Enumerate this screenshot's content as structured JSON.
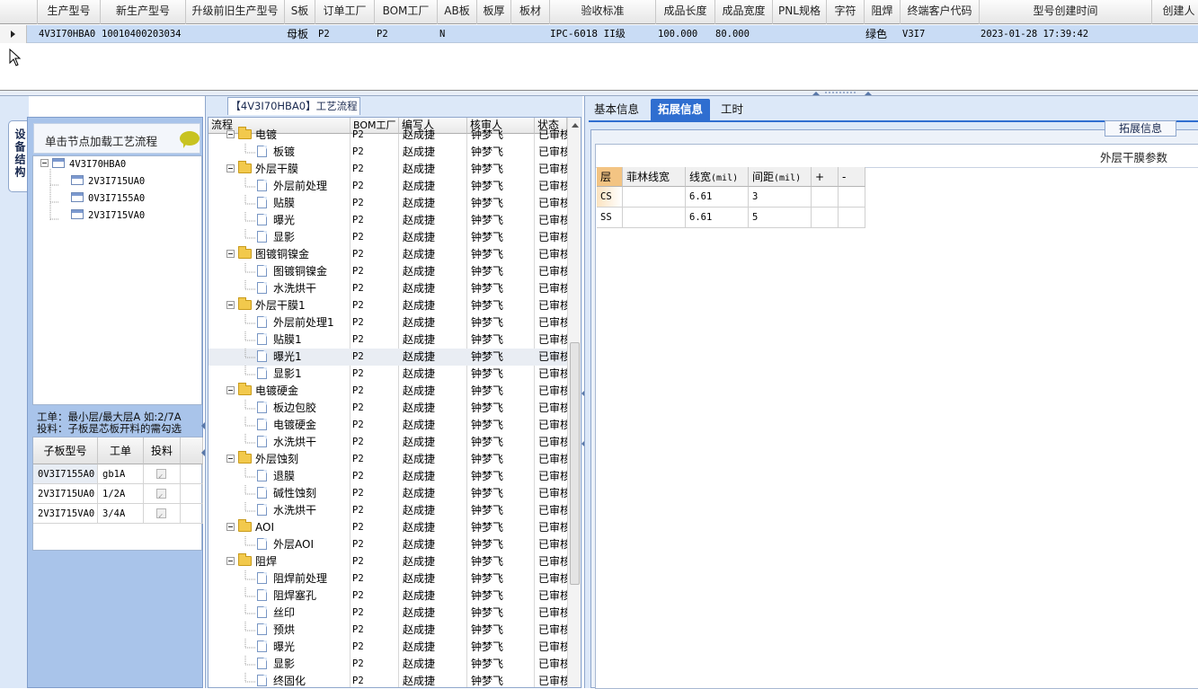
{
  "top_grid": {
    "columns": [
      "生产型号",
      "新生产型号",
      "升级前旧生产型号",
      "S板",
      "订单工厂",
      "BOM工厂",
      "AB板",
      "板厚",
      "板材",
      "验收标准",
      "成品长度",
      "成品宽度",
      "PNL规格",
      "字符",
      "阻焊",
      "终端客户代码",
      "型号创建时间",
      "创建人"
    ],
    "row": {
      "prod_no": "4V3I70HBA0",
      "new_prod_no": "10010400203034",
      "old_prod_no": "",
      "s_board": "母板",
      "order_factory": "P2",
      "bom_factory": "P2",
      "ab_board": "N",
      "thickness": "",
      "material": "",
      "standard": "IPC-6018 II级",
      "length": "100.000",
      "width": "80.000",
      "pnl": "",
      "char": "",
      "solder_mask": "绿色",
      "customer_code": "V3I7",
      "created": "2023-01-28 17:39:42",
      "creator": ""
    }
  },
  "left_panel": {
    "vertical_tab": "设备结构",
    "hint": "单击节点加载工艺流程",
    "tree": {
      "root": "4V3I70HBA0",
      "children": [
        "2V3I715UA0",
        "0V3I7155A0",
        "2V3I715VA0"
      ]
    },
    "info_line1": "工单：最小层/最大层A 如:2/7A",
    "info_line2": "投料：子板是芯板开料的需勾选",
    "sub_grid": {
      "headers": [
        "子板型号",
        "工单",
        "投料"
      ],
      "rows": [
        {
          "model": "0V3I7155A0",
          "order": "gb1A",
          "feed": true
        },
        {
          "model": "2V3I715UA0",
          "order": "1/2A",
          "feed": true
        },
        {
          "model": "2V3I715VA0",
          "order": "3/4A",
          "feed": true
        }
      ]
    }
  },
  "mid_panel": {
    "title": "【4V3I70HBA0】工艺流程",
    "headers": [
      "流程",
      "BOM工厂",
      "编写人",
      "核审人",
      "状态"
    ],
    "rows": [
      {
        "type": "folder",
        "name": "电镀",
        "bom": "P2",
        "author": "赵成捷",
        "reviewer": "钟梦飞",
        "status": "已审核"
      },
      {
        "type": "doc",
        "name": "板镀",
        "bom": "P2",
        "author": "赵成捷",
        "reviewer": "钟梦飞",
        "status": "已审核"
      },
      {
        "type": "folder",
        "name": "外层干膜",
        "bom": "P2",
        "author": "赵成捷",
        "reviewer": "钟梦飞",
        "status": "已审核"
      },
      {
        "type": "doc",
        "name": "外层前处理",
        "bom": "P2",
        "author": "赵成捷",
        "reviewer": "钟梦飞",
        "status": "已审核"
      },
      {
        "type": "doc",
        "name": "贴膜",
        "bom": "P2",
        "author": "赵成捷",
        "reviewer": "钟梦飞",
        "status": "已审核"
      },
      {
        "type": "doc",
        "name": "曝光",
        "bom": "P2",
        "author": "赵成捷",
        "reviewer": "钟梦飞",
        "status": "已审核"
      },
      {
        "type": "doc",
        "name": "显影",
        "bom": "P2",
        "author": "赵成捷",
        "reviewer": "钟梦飞",
        "status": "已审核"
      },
      {
        "type": "folder",
        "name": "图镀铜镍金",
        "bom": "P2",
        "author": "赵成捷",
        "reviewer": "钟梦飞",
        "status": "已审核"
      },
      {
        "type": "doc",
        "name": "图镀铜镍金",
        "bom": "P2",
        "author": "赵成捷",
        "reviewer": "钟梦飞",
        "status": "已审核"
      },
      {
        "type": "doc",
        "name": "水洗烘干",
        "bom": "P2",
        "author": "赵成捷",
        "reviewer": "钟梦飞",
        "status": "已审核"
      },
      {
        "type": "folder",
        "name": "外层干膜1",
        "bom": "P2",
        "author": "赵成捷",
        "reviewer": "钟梦飞",
        "status": "已审核"
      },
      {
        "type": "doc",
        "name": "外层前处理1",
        "bom": "P2",
        "author": "赵成捷",
        "reviewer": "钟梦飞",
        "status": "已审核"
      },
      {
        "type": "doc",
        "name": "贴膜1",
        "bom": "P2",
        "author": "赵成捷",
        "reviewer": "钟梦飞",
        "status": "已审核"
      },
      {
        "type": "doc",
        "name": "曝光1",
        "bom": "P2",
        "author": "赵成捷",
        "reviewer": "钟梦飞",
        "status": "已审核",
        "selected": true
      },
      {
        "type": "doc",
        "name": "显影1",
        "bom": "P2",
        "author": "赵成捷",
        "reviewer": "钟梦飞",
        "status": "已审核"
      },
      {
        "type": "folder",
        "name": "电镀硬金",
        "bom": "P2",
        "author": "赵成捷",
        "reviewer": "钟梦飞",
        "status": "已审核"
      },
      {
        "type": "doc",
        "name": "板边包胶",
        "bom": "P2",
        "author": "赵成捷",
        "reviewer": "钟梦飞",
        "status": "已审核"
      },
      {
        "type": "doc",
        "name": "电镀硬金",
        "bom": "P2",
        "author": "赵成捷",
        "reviewer": "钟梦飞",
        "status": "已审核"
      },
      {
        "type": "doc",
        "name": "水洗烘干",
        "bom": "P2",
        "author": "赵成捷",
        "reviewer": "钟梦飞",
        "status": "已审核"
      },
      {
        "type": "folder",
        "name": "外层蚀刻",
        "bom": "P2",
        "author": "赵成捷",
        "reviewer": "钟梦飞",
        "status": "已审核"
      },
      {
        "type": "doc",
        "name": "退膜",
        "bom": "P2",
        "author": "赵成捷",
        "reviewer": "钟梦飞",
        "status": "已审核"
      },
      {
        "type": "doc",
        "name": "碱性蚀刻",
        "bom": "P2",
        "author": "赵成捷",
        "reviewer": "钟梦飞",
        "status": "已审核"
      },
      {
        "type": "doc",
        "name": "水洗烘干",
        "bom": "P2",
        "author": "赵成捷",
        "reviewer": "钟梦飞",
        "status": "已审核"
      },
      {
        "type": "folder",
        "name": "AOI",
        "bom": "P2",
        "author": "赵成捷",
        "reviewer": "钟梦飞",
        "status": "已审核"
      },
      {
        "type": "doc",
        "name": "外层AOI",
        "bom": "P2",
        "author": "赵成捷",
        "reviewer": "钟梦飞",
        "status": "已审核"
      },
      {
        "type": "folder",
        "name": "阻焊",
        "bom": "P2",
        "author": "赵成捷",
        "reviewer": "钟梦飞",
        "status": "已审核"
      },
      {
        "type": "doc",
        "name": "阻焊前处理",
        "bom": "P2",
        "author": "赵成捷",
        "reviewer": "钟梦飞",
        "status": "已审核"
      },
      {
        "type": "doc",
        "name": "阻焊塞孔",
        "bom": "P2",
        "author": "赵成捷",
        "reviewer": "钟梦飞",
        "status": "已审核"
      },
      {
        "type": "doc",
        "name": "丝印",
        "bom": "P2",
        "author": "赵成捷",
        "reviewer": "钟梦飞",
        "status": "已审核"
      },
      {
        "type": "doc",
        "name": "预烘",
        "bom": "P2",
        "author": "赵成捷",
        "reviewer": "钟梦飞",
        "status": "已审核"
      },
      {
        "type": "doc",
        "name": "曝光",
        "bom": "P2",
        "author": "赵成捷",
        "reviewer": "钟梦飞",
        "status": "已审核"
      },
      {
        "type": "doc",
        "name": "显影",
        "bom": "P2",
        "author": "赵成捷",
        "reviewer": "钟梦飞",
        "status": "已审核"
      },
      {
        "type": "doc",
        "name": "终固化",
        "bom": "P2",
        "author": "赵成捷",
        "reviewer": "钟梦飞",
        "status": "已审核"
      }
    ]
  },
  "right_panel": {
    "tabs": [
      "基本信息",
      "拓展信息",
      "工时"
    ],
    "active_tab": "拓展信息",
    "group_title": "拓展信息",
    "caption": "外层干膜参数",
    "grid": {
      "headers": [
        "层",
        "菲林线宽",
        "线宽",
        "间距",
        "+",
        "-"
      ],
      "unit": "(mil)",
      "rows": [
        {
          "layer": "CS",
          "film_width": "",
          "line_width": "6.61",
          "spacing": "3"
        },
        {
          "layer": "SS",
          "film_width": "",
          "line_width": "6.61",
          "spacing": "5"
        }
      ]
    }
  },
  "colors": {
    "panel_bg": "#dce8f8",
    "left_panel_bg": "#a9c4ea",
    "active_tab": "#2f6ed0",
    "selected_row": "#c9dcf5",
    "layer_header": "#f3c483",
    "folder": "#f2c94c"
  }
}
